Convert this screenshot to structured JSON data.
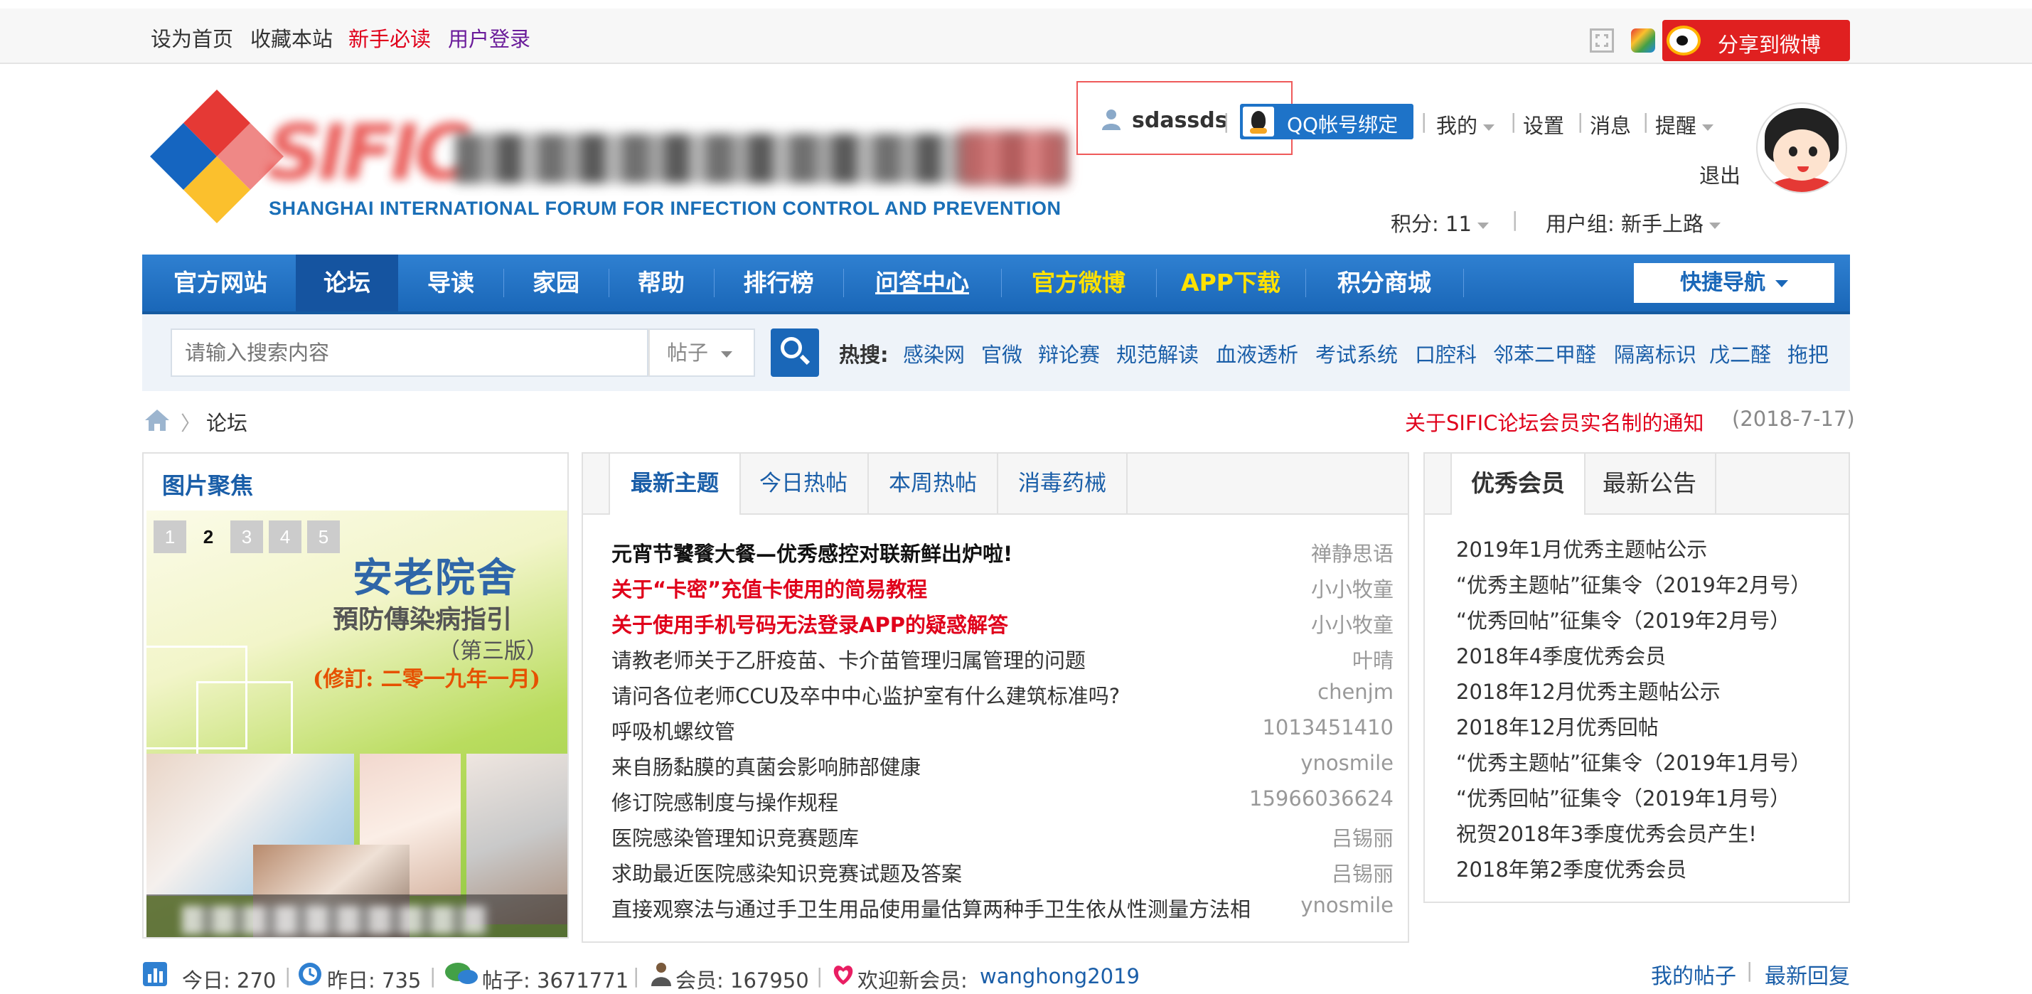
{
  "topbar": {
    "set_home": "设为首页",
    "bookmark": "收藏本站",
    "newbie": "新手必读",
    "login": "用户登录",
    "weibo_share": "分享到微博"
  },
  "header": {
    "logo_letters": "SIFIC",
    "logo_english": "SHANGHAI INTERNATIONAL FORUM FOR INFECTION CONTROL AND PREVENTION",
    "username": "sdassds",
    "qq_bind": "QQ帐号绑定",
    "menu_mine": "我的",
    "menu_settings": "设置",
    "menu_messages": "消息",
    "menu_remind": "提醒",
    "logout": "退出",
    "points": "积分: 11",
    "user_group": "用户组: 新手上路"
  },
  "nav": {
    "items": [
      "官方网站",
      "论坛",
      "导读",
      "家园",
      "帮助",
      "排行榜",
      "问答中心",
      "官方微博",
      "APP下载",
      "积分商城"
    ],
    "active_index": 1,
    "quick_nav": "快捷导航"
  },
  "search": {
    "placeholder": "请输入搜索内容",
    "type": "帖子",
    "hot_label": "热搜:",
    "hot_terms": [
      "感染网",
      "官微",
      "辩论赛",
      "规范解读",
      "血液透析",
      "考试系统",
      "口腔科",
      "邻苯二甲醛",
      "隔离标识",
      "戊二醛",
      "拖把"
    ]
  },
  "breadcrumb": {
    "current": "论坛",
    "notice": "关于SIFIC论坛会员实名制的通知",
    "notice_date": "(2018-7-17)"
  },
  "image_focus": {
    "title": "图片聚焦",
    "slide_numbers": [
      "1",
      "2",
      "3",
      "4",
      "5"
    ],
    "active_slide": 2,
    "slide_title": "安老院舍",
    "slide_subtitle": "預防傳染病指引",
    "slide_edition": "（第三版）",
    "slide_revised": "(修訂: 二零一九年一月)"
  },
  "threads": {
    "tabs": [
      "最新主题",
      "今日热帖",
      "本周热帖",
      "消毒药械"
    ],
    "active_tab": 0,
    "rows": [
      {
        "title": "元宵节饕餮大餐—优秀感控对联新鲜出炉啦!",
        "author": "禅静思语",
        "style": "bold"
      },
      {
        "title": "关于“卡密”充值卡使用的简易教程",
        "author": "小小牧童",
        "style": "red"
      },
      {
        "title": "关于使用手机号码无法登录APP的疑惑解答",
        "author": "小小牧童",
        "style": "red"
      },
      {
        "title": "请教老师关于乙肝疫苗、卡介苗管理归属管理的问题",
        "author": "叶晴",
        "style": "normal"
      },
      {
        "title": "请问各位老师CCU及卒中中心监护室有什么建筑标准吗?",
        "author": "chenjm",
        "style": "normal"
      },
      {
        "title": "呼吸机螺纹管",
        "author": "1013451410",
        "style": "normal"
      },
      {
        "title": "来自肠黏膜的真菌会影响肺部健康",
        "author": "ynosmile",
        "style": "normal"
      },
      {
        "title": "修订院感制度与操作规程",
        "author": "15966036624",
        "style": "normal"
      },
      {
        "title": "医院感染管理知识竞赛题库",
        "author": "吕锡丽",
        "style": "normal"
      },
      {
        "title": "求助最近医院感染知识竞赛试题及答案",
        "author": "吕锡丽",
        "style": "normal"
      },
      {
        "title": "直接观察法与通过手卫生用品使用量估算两种手卫生依从性测量方法相",
        "author": "ynosmile",
        "style": "normal"
      }
    ]
  },
  "right_panel": {
    "tabs": [
      "优秀会员",
      "最新公告"
    ],
    "active_tab": 0,
    "items": [
      "2019年1月优秀主题帖公示",
      "“优秀主题帖”征集令（2019年2月号）",
      "“优秀回帖”征集令（2019年2月号）",
      "2018年4季度优秀会员",
      "2018年12月优秀主题帖公示",
      "2018年12月优秀回帖",
      "“优秀主题帖”征集令（2019年1月号）",
      "“优秀回帖”征集令（2019年1月号）",
      "祝贺2018年3季度优秀会员产生!",
      "2018年第2季度优秀会员"
    ]
  },
  "stats": {
    "today": "今日: 270",
    "yesterday": "昨日: 735",
    "posts": "帖子: 3671771",
    "members": "会员: 167950",
    "welcome": "欢迎新会员:",
    "new_member": "wanghong2019",
    "my_posts": "我的帖子",
    "latest_replies": "最新回复"
  },
  "colors": {
    "nav_blue": "#1a67b8",
    "link_blue": "#1a5ea8",
    "alert_red": "#e0001b",
    "nav_highlight_yellow": "#ffe100"
  }
}
